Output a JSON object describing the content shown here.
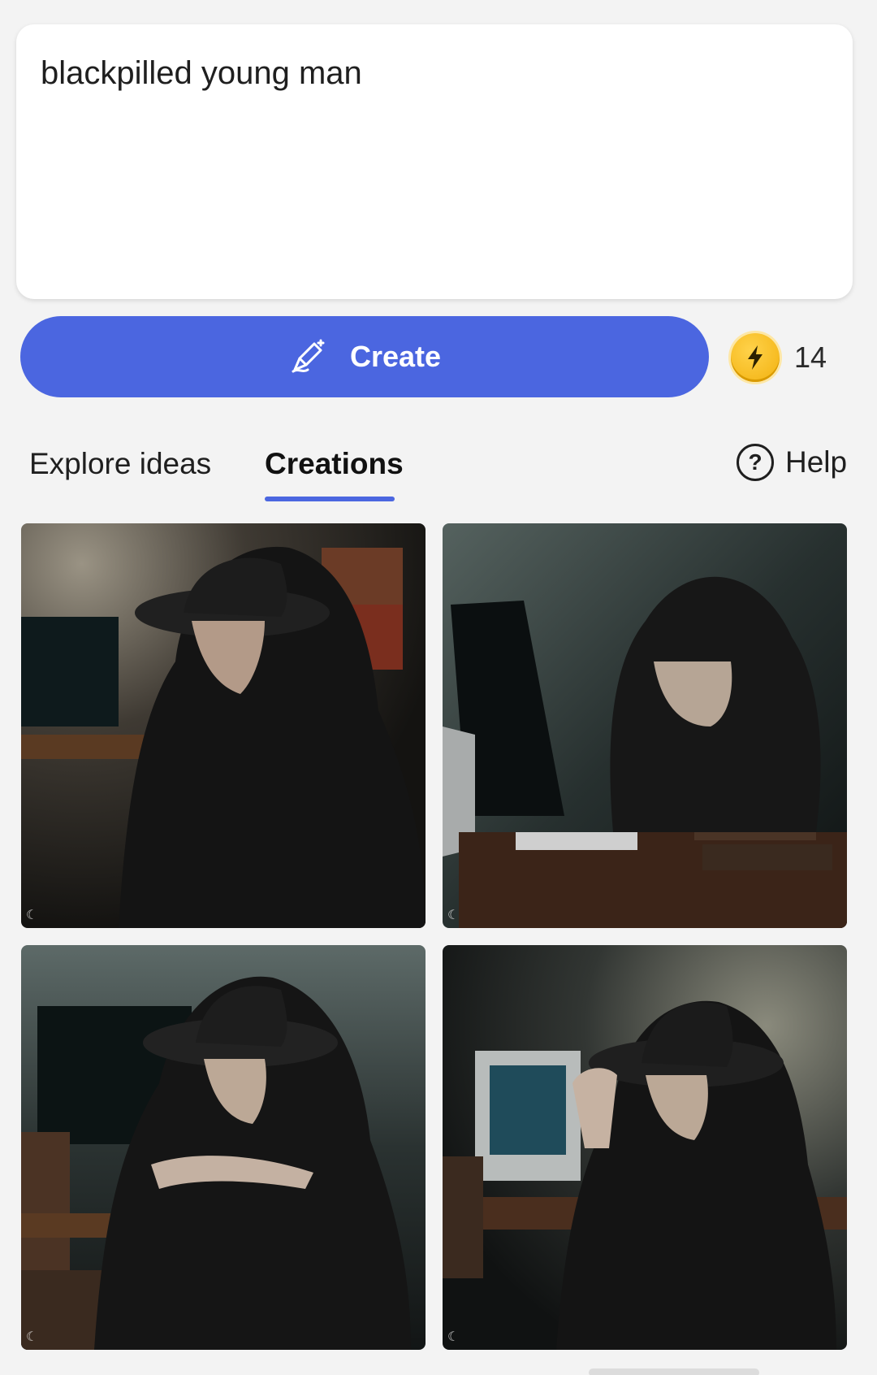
{
  "prompt": {
    "text": "blackpilled young man"
  },
  "create": {
    "label": "Create",
    "icon": "magic-pencil-icon"
  },
  "coins": {
    "count": "14",
    "icon": "bolt-coin-icon",
    "color": "#f2b10f"
  },
  "tabs": [
    {
      "label": "Explore ideas",
      "active": false
    },
    {
      "label": "Creations",
      "active": true
    }
  ],
  "help": {
    "label": "Help",
    "icon": "question-circle-icon"
  },
  "accent": "#4b66e0",
  "images": [
    {
      "subject": "hooded man in fedora seated at desk with monitor and books"
    },
    {
      "subject": "hooded man head in hands beside computer monitor"
    },
    {
      "subject": "hooded man in fedora with arms on knees near books"
    },
    {
      "subject": "man in fedora touching hat brim near glowing monitor"
    }
  ]
}
